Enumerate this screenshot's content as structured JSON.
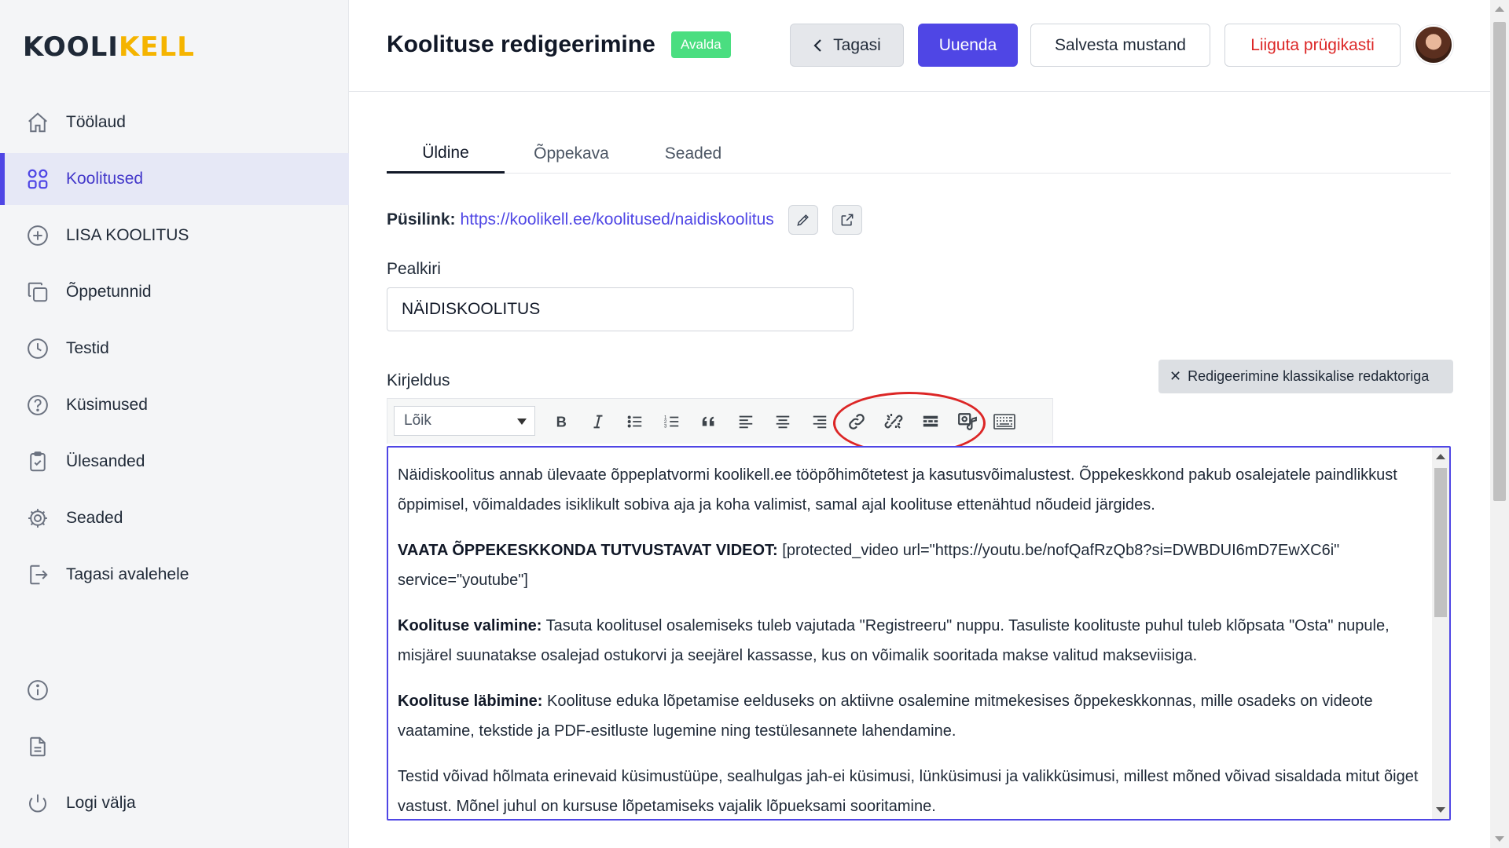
{
  "logo": {
    "part1": "KOOLI",
    "part2": "KELL"
  },
  "sidebar": {
    "items": [
      {
        "label": "Töölaud",
        "icon": "home-icon",
        "active": false
      },
      {
        "label": "Koolitused",
        "icon": "grid-icon",
        "active": true
      },
      {
        "label": "LISA KOOLITUS",
        "icon": "plus-circle-icon",
        "active": false
      },
      {
        "label": "Õppetunnid",
        "icon": "copy-icon",
        "active": false
      },
      {
        "label": "Testid",
        "icon": "clock-icon",
        "active": false
      },
      {
        "label": "Küsimused",
        "icon": "question-circle-icon",
        "active": false
      },
      {
        "label": "Ülesanded",
        "icon": "clipboard-check-icon",
        "active": false
      },
      {
        "label": "Seaded",
        "icon": "gear-icon",
        "active": false
      },
      {
        "label": "Tagasi avalehele",
        "icon": "exit-icon",
        "active": false
      }
    ],
    "bottom": {
      "info_icon": "info-icon",
      "doc_icon": "document-icon",
      "logout_label": "Logi välja",
      "logout_icon": "power-icon"
    }
  },
  "header": {
    "title": "Koolituse redigeerimine",
    "badge": "Avalda",
    "back_label": "Tagasi",
    "update_label": "Uuenda",
    "draft_label": "Salvesta mustand",
    "trash_label": "Liiguta prügikasti"
  },
  "tabs": [
    {
      "label": "Üldine",
      "active": true
    },
    {
      "label": "Õppekava",
      "active": false
    },
    {
      "label": "Seaded",
      "active": false
    }
  ],
  "permalink": {
    "label": "Püsilink:",
    "url": "https://koolikell.ee/koolitused/naidiskoolitus"
  },
  "title_field": {
    "label": "Pealkiri",
    "value": "NÄIDISKOOLITUS"
  },
  "description": {
    "label": "Kirjeldus",
    "classic_editor_label": "Redigeerimine klassikalise redaktoriga",
    "format_select": "Lõik",
    "toolbar_icons": [
      "bold-icon",
      "italic-icon",
      "bullet-list-icon",
      "numbered-list-icon",
      "blockquote-icon",
      "align-left-icon",
      "align-center-icon",
      "align-right-icon",
      "link-icon",
      "unlink-icon",
      "read-more-icon",
      "media-icon",
      "keyboard-icon"
    ],
    "paragraphs": [
      {
        "bold": "",
        "text": "Näidiskoolitus annab ülevaate õppeplatvormi koolikell.ee tööpõhimõtetest ja kasutusvõimalustest. Õppekeskkond pakub osalejatele paindlikkust õppimisel, võimaldades isiklikult sobiva aja ja koha valimist, samal ajal koolituse ettenähtud nõudeid järgides."
      },
      {
        "bold": "VAATA ÕPPEKESKKONDA TUTVUSTAVAT VIDEOT:",
        "text": " [protected_video url=\"https://youtu.be/nofQafRzQb8?si=DWBDUI6mD7EwXC6i\" service=\"youtube\"]"
      },
      {
        "bold": "Koolituse valimine:",
        "text": " Tasuta koolitusel osalemiseks tuleb vajutada \"Registreeru\" nuppu. Tasuliste koolituste puhul tuleb klõpsata \"Osta\" nupule, misjärel suunatakse osalejad ostukorvi ja seejärel kassasse, kus on võimalik sooritada makse valitud makseviisiga."
      },
      {
        "bold": "Koolituse läbimine:",
        "text": " Koolituse eduka lõpetamise eelduseks on aktiivne osalemine mitmekesises õppekeskkonnas, mille osadeks on videote vaatamine, tekstide ja PDF-esitluste lugemine ning testülesannete lahendamine."
      },
      {
        "bold": "",
        "text": "Testid võivad hõlmata erinevaid küsimustüüpe, sealhulgas jah-ei küsimusi, lünküsimusi ja valikküsimusi, millest mõned võivad sisaldada mitut õiget vastust. Mõnel juhul on kursuse lõpetamiseks vajalik lõpueksami sooritamine."
      }
    ]
  },
  "colors": {
    "accent": "#4f46e5",
    "badge": "#4ade80",
    "danger": "#dc2626",
    "logo_yellow": "#f5b400"
  }
}
